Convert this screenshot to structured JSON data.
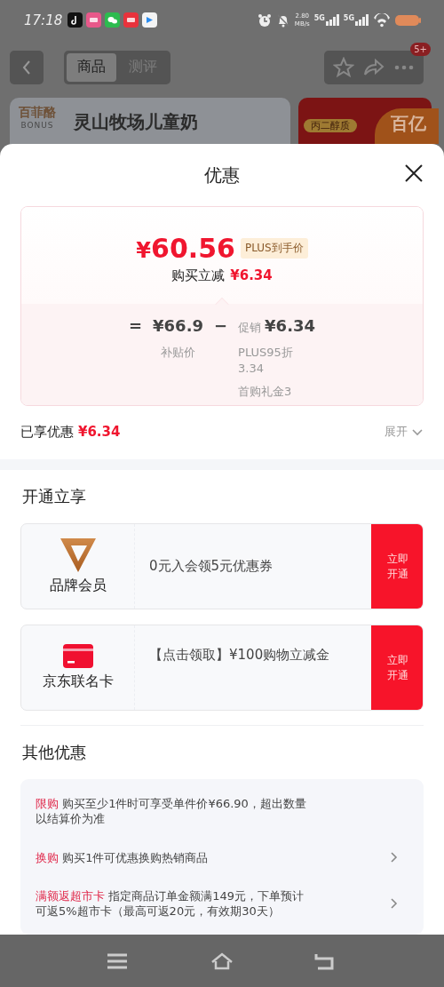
{
  "status_bar": {
    "time": "17:18",
    "net_speed": "2.80",
    "net_unit": "MB/s",
    "signals": [
      "5G",
      "5G"
    ]
  },
  "nav": {
    "tabs": [
      {
        "label": "商品",
        "selected": true
      },
      {
        "label": "测评",
        "selected": false
      }
    ],
    "badge": "5+"
  },
  "banner": {
    "logo": "百菲酪",
    "logo_sub": "BONUS",
    "title": "灵山牧场儿童奶",
    "side_tag": "丙二醇质",
    "side_badge": "百亿"
  },
  "sheet": {
    "title": "优惠",
    "price_card": {
      "currency": "¥",
      "price": "60.56",
      "price_tag": "PLUS到手价",
      "cut_label": "购买立减",
      "cut_amount": "¥6.34",
      "breakdown": [
        {
          "kind": "operator",
          "text": "="
        },
        {
          "kind": "term",
          "value": "¥66.9",
          "notes": [
            "补贴价"
          ]
        },
        {
          "kind": "operator",
          "text": "−"
        },
        {
          "kind": "term",
          "label": "促销",
          "value": "¥6.34",
          "notes": [
            "PLUS95折 3.34",
            "首购礼金3"
          ]
        }
      ]
    },
    "enjoyed": {
      "label": "已享优惠",
      "amount": "¥6.34",
      "expand": "展开"
    },
    "open_section": {
      "title": "开通立享",
      "cards": [
        {
          "kind": "brand_member",
          "name": "品牌会员",
          "desc": "0元入会领5元优惠券",
          "action": "立即开通"
        },
        {
          "kind": "co_card",
          "name": "京东联名卡",
          "desc": "【点击领取】¥100购物立减金",
          "action": "立即开通"
        }
      ]
    },
    "other_section": {
      "title": "其他优惠",
      "items": [
        {
          "tag": "限购",
          "text": "购买至少1件时可享受单件价¥66.90，超出数量以结算价为准",
          "has_arrow": false
        },
        {
          "tag": "换购",
          "text": "购买1件可优惠换购热销商品",
          "has_arrow": true
        },
        {
          "tag": "满额返超市卡",
          "text": "指定商品订单金额满149元，下单预计可返5%超市卡（最高可返20元，有效期30天）",
          "has_arrow": true
        }
      ]
    }
  }
}
